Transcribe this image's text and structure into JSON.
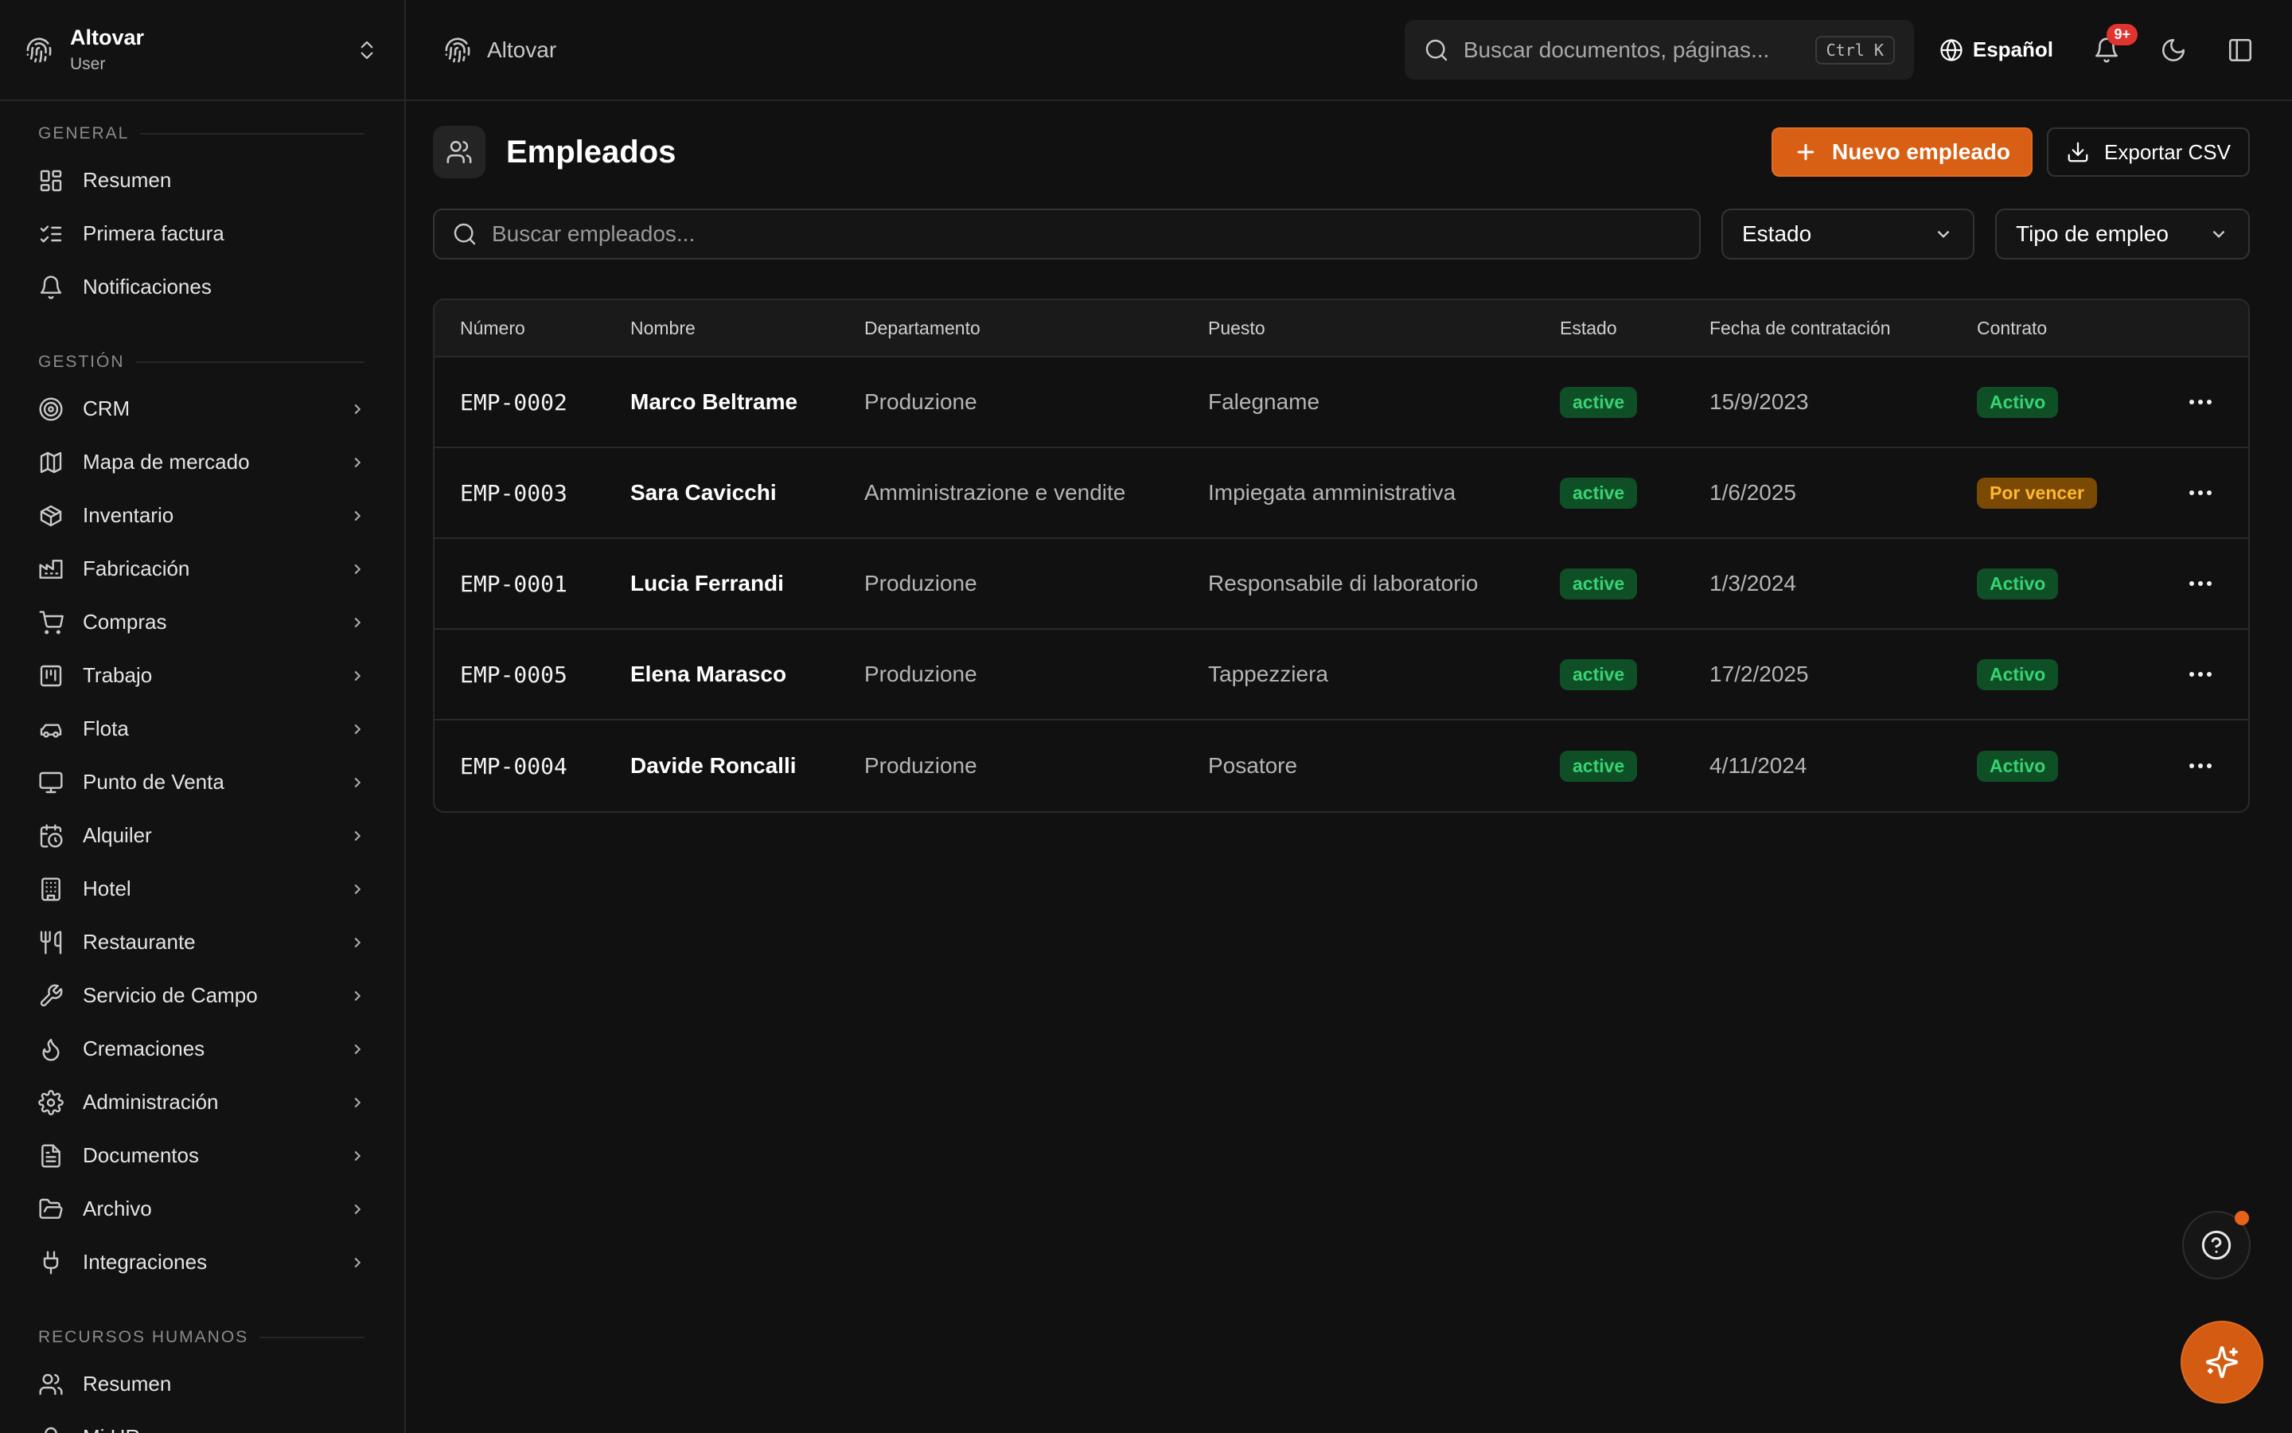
{
  "brand": {
    "name": "Altovar",
    "role": "User"
  },
  "topbar": {
    "breadcrumb": "Altovar",
    "search_placeholder": "Buscar documentos, páginas...",
    "search_shortcut": "Ctrl K",
    "language": "Español",
    "notifications_badge": "9+"
  },
  "sidebar": {
    "general_label": "GENERAL",
    "general_items": [
      {
        "label": "Resumen",
        "icon": "dashboard-icon"
      },
      {
        "label": "Primera factura",
        "icon": "checklist-icon"
      },
      {
        "label": "Notificaciones",
        "icon": "bell-icon"
      }
    ],
    "gestion_label": "GESTIÓN",
    "gestion_items": [
      {
        "label": "CRM",
        "icon": "target-icon"
      },
      {
        "label": "Mapa de mercado",
        "icon": "map-icon"
      },
      {
        "label": "Inventario",
        "icon": "box-icon"
      },
      {
        "label": "Fabricación",
        "icon": "factory-icon"
      },
      {
        "label": "Compras",
        "icon": "cart-icon"
      },
      {
        "label": "Trabajo",
        "icon": "kanban-icon"
      },
      {
        "label": "Flota",
        "icon": "car-icon"
      },
      {
        "label": "Punto de Venta",
        "icon": "monitor-icon"
      },
      {
        "label": "Alquiler",
        "icon": "calendar-clock-icon"
      },
      {
        "label": "Hotel",
        "icon": "building-icon"
      },
      {
        "label": "Restaurante",
        "icon": "utensils-icon"
      },
      {
        "label": "Servicio de Campo",
        "icon": "wrench-icon"
      },
      {
        "label": "Cremaciones",
        "icon": "flame-icon"
      },
      {
        "label": "Administración",
        "icon": "gear-icon"
      },
      {
        "label": "Documentos",
        "icon": "file-icon"
      },
      {
        "label": "Archivo",
        "icon": "folder-open-icon"
      },
      {
        "label": "Integraciones",
        "icon": "plug-icon"
      }
    ],
    "hr_label": "RECURSOS HUMANOS",
    "hr_items": [
      {
        "label": "Resumen",
        "icon": "users-icon"
      },
      {
        "label": "Mi HR",
        "icon": "user-icon"
      }
    ]
  },
  "page": {
    "title": "Empleados",
    "new_button": "Nuevo empleado",
    "export_button": "Exportar CSV",
    "search_placeholder": "Buscar empleados...",
    "filter_status": "Estado",
    "filter_type": "Tipo de empleo"
  },
  "table": {
    "headers": [
      "Número",
      "Nombre",
      "Departamento",
      "Puesto",
      "Estado",
      "Fecha de contratación",
      "Contrato"
    ],
    "rows": [
      {
        "number": "EMP-0002",
        "name": "Marco Beltrame",
        "department": "Produzione",
        "position": "Falegname",
        "status": "active",
        "hire_date": "15/9/2023",
        "contract": "Activo",
        "contract_tone": "green"
      },
      {
        "number": "EMP-0003",
        "name": "Sara Cavicchi",
        "department": "Amministrazione e vendite",
        "position": "Impiegata amministrativa",
        "status": "active",
        "hire_date": "1/6/2025",
        "contract": "Por vencer",
        "contract_tone": "orange"
      },
      {
        "number": "EMP-0001",
        "name": "Lucia Ferrandi",
        "department": "Produzione",
        "position": "Responsabile di laboratorio",
        "status": "active",
        "hire_date": "1/3/2024",
        "contract": "Activo",
        "contract_tone": "green"
      },
      {
        "number": "EMP-0005",
        "name": "Elena Marasco",
        "department": "Produzione",
        "position": "Tappezziera",
        "status": "active",
        "hire_date": "17/2/2025",
        "contract": "Activo",
        "contract_tone": "green"
      },
      {
        "number": "EMP-0004",
        "name": "Davide Roncalli",
        "department": "Produzione",
        "position": "Posatore",
        "status": "active",
        "hire_date": "4/11/2024",
        "contract": "Activo",
        "contract_tone": "green"
      }
    ]
  },
  "colors": {
    "accent": "#d85f14",
    "success": "#37d374",
    "warning": "#ffb72c",
    "danger": "#e0342f"
  }
}
